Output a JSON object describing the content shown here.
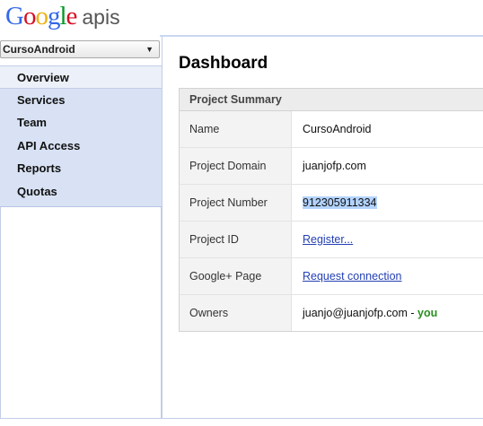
{
  "header": {
    "logo_letters": [
      "G",
      "o",
      "o",
      "g",
      "l",
      "e"
    ],
    "logo_suffix": "apis"
  },
  "project_selector": {
    "value": "CursoAndroid",
    "arrow": "▼"
  },
  "sidebar": {
    "items": [
      {
        "label": "Overview",
        "active": true
      },
      {
        "label": "Services"
      },
      {
        "label": "Team"
      },
      {
        "label": "API Access"
      },
      {
        "label": "Reports"
      },
      {
        "label": "Quotas"
      }
    ]
  },
  "main": {
    "title": "Dashboard",
    "summary": {
      "heading": "Project Summary",
      "name_label": "Name",
      "name_value": "CursoAndroid",
      "domain_label": "Project Domain",
      "domain_value": "juanjofp.com",
      "number_label": "Project Number",
      "number_value": "912305911334",
      "id_label": "Project ID",
      "id_link": "Register...",
      "gplus_label": "Google+ Page",
      "gplus_link": "Request connection",
      "owners_label": "Owners",
      "owners_value": "juanjo@juanjofp.com",
      "owners_separator": " - ",
      "owners_you": "you"
    }
  },
  "colors": {
    "nav_bg": "#d8e2f4",
    "link": "#2440b3",
    "you": "#2a8f1f",
    "selection": "#b3d3ff"
  }
}
